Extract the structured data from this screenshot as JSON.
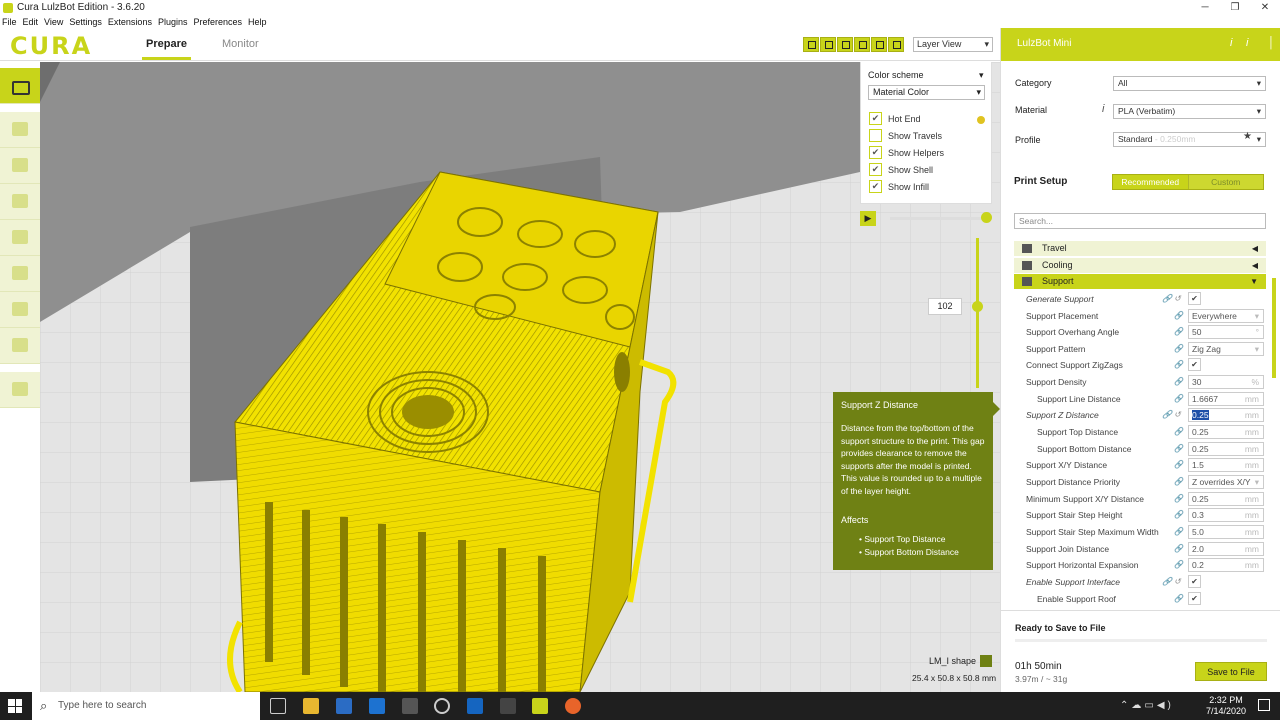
{
  "window": {
    "title": "Cura LulzBot Edition - 3.6.20",
    "controls": [
      "─",
      "❐",
      "✕"
    ]
  },
  "menu": [
    "File",
    "Edit",
    "View",
    "Settings",
    "Extensions",
    "Plugins",
    "Preferences",
    "Help"
  ],
  "header": {
    "logo": "CURA",
    "tabs": [
      "Prepare",
      "Monitor"
    ],
    "view_mode": "Layer View"
  },
  "layer_panel": {
    "color_scheme_label": "Color scheme",
    "color_scheme_value": "Material Color",
    "options": [
      {
        "label": "Hot End",
        "checked": true
      },
      {
        "label": "Show Travels",
        "checked": false
      },
      {
        "label": "Show Helpers",
        "checked": true
      },
      {
        "label": "Show Shell",
        "checked": true
      },
      {
        "label": "Show Infill",
        "checked": true
      }
    ],
    "hot_end_color": "#e0c321",
    "current_layer": "102"
  },
  "tooltip": {
    "title": "Support Z Distance",
    "body": "Distance from the top/bottom of the support structure to the print. This gap provides clearance to remove the supports after the model is printed. This value is rounded up to a multiple of the layer height.",
    "affects_label": "Affects",
    "affects": [
      "Support Top Distance",
      "Support Bottom Distance"
    ]
  },
  "object": {
    "name": "LM_I shape",
    "dims": "25.4 x 50.8 x 50.8 mm"
  },
  "right_panel": {
    "printer": "LulzBot Mini",
    "category_label": "Category",
    "category_value": "All",
    "material_label": "Material",
    "material_value": "PLA (Verbatim)",
    "profile_label": "Profile",
    "profile_value": "Standard",
    "profile_extra": "- 0.250mm",
    "print_setup": "Print Setup",
    "mode_recommended": "Recommended",
    "mode_custom": "Custom",
    "search_placeholder": "Search...",
    "categories": [
      "Travel",
      "Cooling",
      "Support"
    ],
    "settings": [
      {
        "label": "Generate Support",
        "type": "check",
        "value": "✔"
      },
      {
        "label": "Support Placement",
        "value": "Everywhere",
        "unit": ""
      },
      {
        "label": "Support Overhang Angle",
        "value": "50",
        "unit": "°"
      },
      {
        "label": "Support Pattern",
        "value": "Zig Zag",
        "unit": ""
      },
      {
        "label": "Connect Support ZigZags",
        "type": "check",
        "value": "✔"
      },
      {
        "label": "Support Density",
        "value": "30",
        "unit": "%"
      },
      {
        "label": "Support Line Distance",
        "value": "1.6667",
        "unit": "mm"
      },
      {
        "label": "Support Z Distance",
        "value": "0.25",
        "unit": "mm"
      },
      {
        "label": "Support Top Distance",
        "value": "0.25",
        "unit": "mm"
      },
      {
        "label": "Support Bottom Distance",
        "value": "0.25",
        "unit": "mm"
      },
      {
        "label": "Support X/Y Distance",
        "value": "1.5",
        "unit": "mm"
      },
      {
        "label": "Support Distance Priority",
        "value": "Z overrides X/Y",
        "unit": ""
      },
      {
        "label": "Minimum Support X/Y Distance",
        "value": "0.25",
        "unit": "mm"
      },
      {
        "label": "Support Stair Step Height",
        "value": "0.3",
        "unit": "mm"
      },
      {
        "label": "Support Stair Step Maximum Width",
        "value": "5.0",
        "unit": "mm"
      },
      {
        "label": "Support Join Distance",
        "value": "2.0",
        "unit": "mm"
      },
      {
        "label": "Support Horizontal Expansion",
        "value": "0.2",
        "unit": "mm"
      },
      {
        "label": "Enable Support Interface",
        "type": "check",
        "value": "✔"
      },
      {
        "label": "Enable Support Roof",
        "type": "check",
        "value": "✔"
      }
    ],
    "ready": "Ready to Save to File",
    "print_time": "01h 50min",
    "print_material": "3.97m / ~ 31g",
    "save_button": "Save to File"
  },
  "taskbar": {
    "search_placeholder": "Type here to search",
    "time": "2:32 PM",
    "date": "7/14/2020"
  },
  "colors": {
    "accent": "#c8d41a",
    "accent_dark": "#6f8114",
    "model": "#f2e200"
  }
}
